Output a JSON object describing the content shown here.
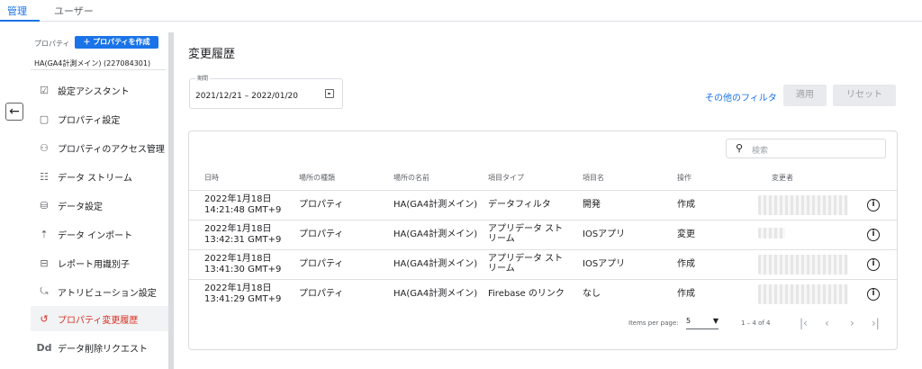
{
  "top_tabs": [
    {
      "label": "管理"
    },
    {
      "label": "ユーザー"
    }
  ],
  "sidebar": {
    "property_label": "プロパティ",
    "create_button": "＋ プロパティを作成",
    "property_id": "HA(GA4計測メイン) (227084301)",
    "items": [
      {
        "label": "設定アシスタント",
        "icon": "☑"
      },
      {
        "label": "プロパティ設定",
        "icon": "▢"
      },
      {
        "label": "プロパティのアクセス管理",
        "icon": "⚇"
      },
      {
        "label": "データ ストリーム",
        "icon": "☷"
      },
      {
        "label": "データ設定",
        "icon": "⛁"
      },
      {
        "label": "データ インポート",
        "icon": "⇡"
      },
      {
        "label": "レポート用識別子",
        "icon": "⊟"
      },
      {
        "label": "アトリビューション設定",
        "icon": "⤿"
      },
      {
        "label": "プロパティ変更履歴",
        "icon": "↺"
      },
      {
        "label": "データ削除リクエスト",
        "icon": "Dd"
      }
    ]
  },
  "main": {
    "title": "変更履歴",
    "period_label": "期間",
    "period_value": "2021/12/21 – 2022/01/20",
    "other_filters": "その他のフィルタ",
    "apply": "適用",
    "reset": "リセット",
    "search_placeholder": "検索",
    "columns": [
      "日時",
      "場所の種類",
      "場所の名前",
      "項目タイプ",
      "項目名",
      "操作",
      "変更者"
    ],
    "rows": [
      {
        "date": "2022年1月18日",
        "time": "14:21:48 GMT+9",
        "loc_type": "プロパティ",
        "loc_name": "HA(GA4計測メイン)",
        "item_type": "データフィルタ",
        "item_name": "開発",
        "op": "作成"
      },
      {
        "date": "2022年1月18日",
        "time": "13:42:31 GMT+9",
        "loc_type": "プロパティ",
        "loc_name": "HA(GA4計測メイン)",
        "item_type": "アプリデータ ストリーム",
        "item_name": "IOSアプリ",
        "op": "変更"
      },
      {
        "date": "2022年1月18日",
        "time": "13:41:30 GMT+9",
        "loc_type": "プロパティ",
        "loc_name": "HA(GA4計測メイン)",
        "item_type": "アプリデータ ストリーム",
        "item_name": "IOSアプリ",
        "op": "作成"
      },
      {
        "date": "2022年1月18日",
        "time": "13:41:29 GMT+9",
        "loc_type": "プロパティ",
        "loc_name": "HA(GA4計測メイン)",
        "item_type": "Firebase のリンク",
        "item_name": "なし",
        "op": "作成"
      }
    ],
    "items_per_page_label": "Items per page:",
    "items_per_page": "5",
    "range": "1 – 4 of 4"
  },
  "colors": {
    "accent": "#1a73e8",
    "active": "#d93025"
  }
}
